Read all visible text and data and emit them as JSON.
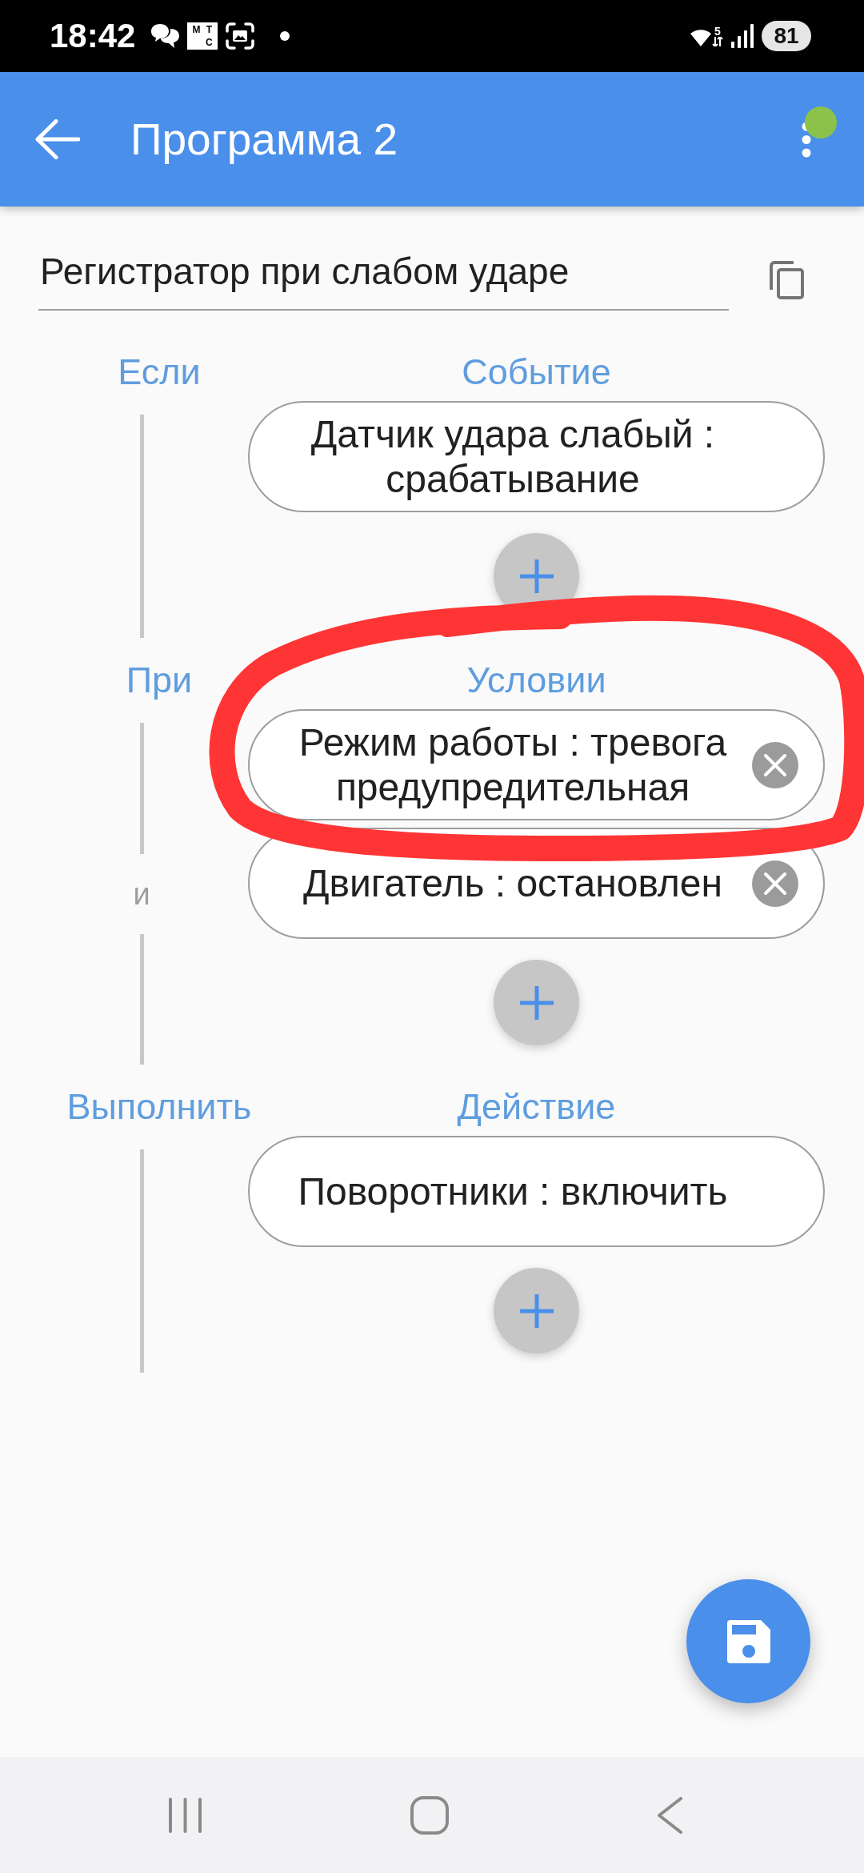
{
  "status_bar": {
    "time": "18:42",
    "carrier_logo": [
      "М",
      "Т",
      "С"
    ],
    "wifi_band": "5",
    "battery": "81"
  },
  "app_bar": {
    "title": "Программа 2",
    "notification_dot": true
  },
  "program_name": {
    "value": "Регистратор при слабом ударе"
  },
  "sections": [
    {
      "side_label": "Если",
      "label": "Событие",
      "items": [
        {
          "text": "Датчик удара слабый : срабатывание",
          "removable": false
        }
      ]
    },
    {
      "side_label": "При",
      "label": "Условии",
      "items": [
        {
          "text": "Режим работы : тревога предупредительная",
          "removable": true
        },
        {
          "text": "Двигатель : остановлен",
          "removable": true
        }
      ],
      "conjunctions": [
        "и"
      ]
    },
    {
      "side_label": "Выполнить",
      "label": "Действие",
      "items": [
        {
          "text": "Поворотники : включить",
          "removable": false
        }
      ]
    }
  ]
}
